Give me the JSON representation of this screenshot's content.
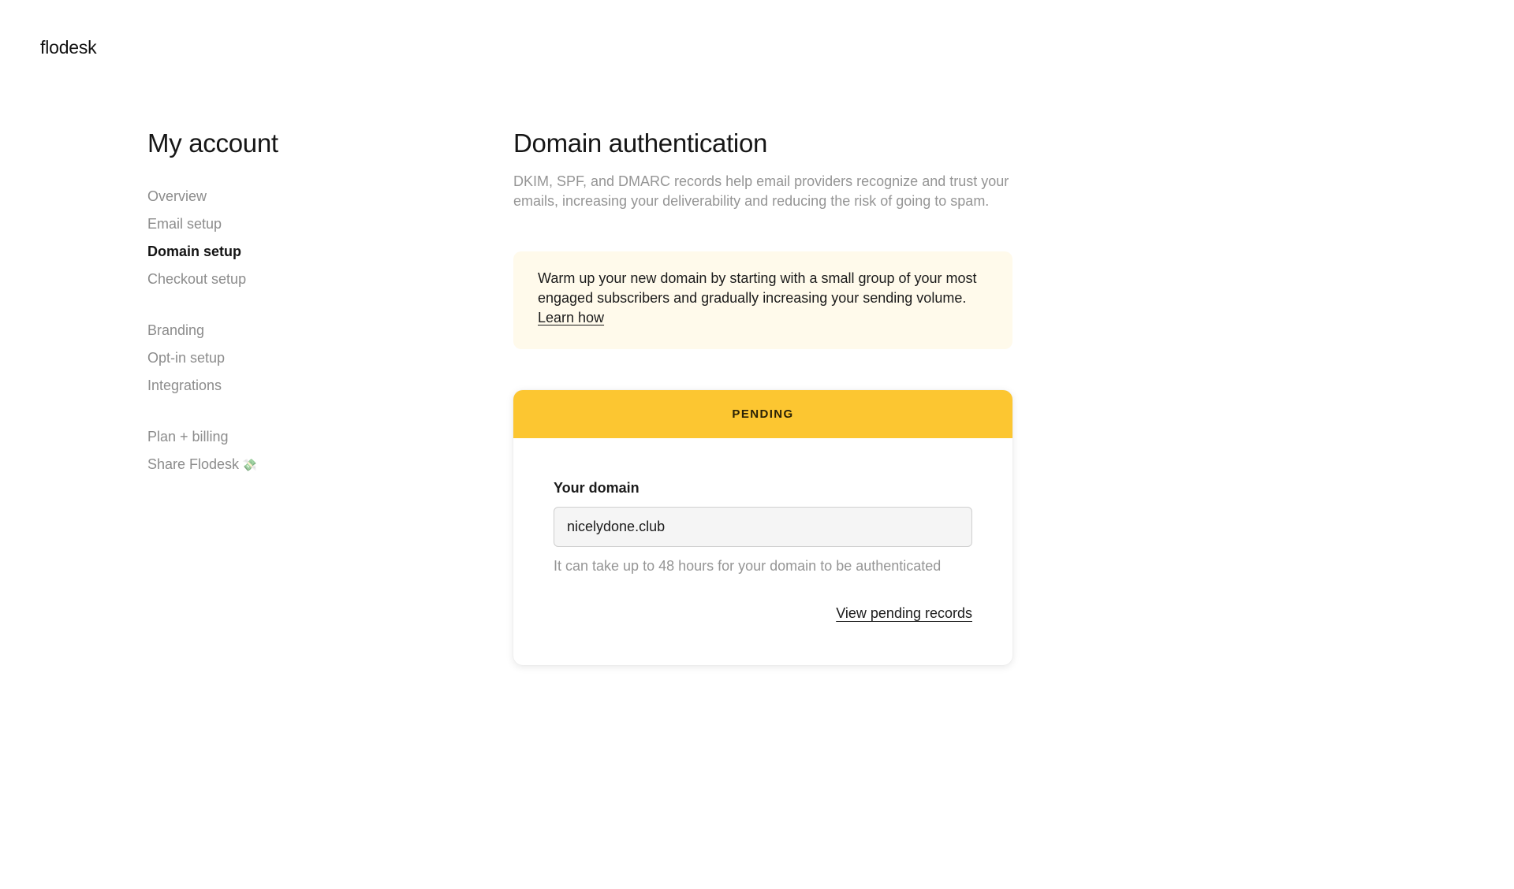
{
  "brand": {
    "logo_text": "flodesk"
  },
  "sidebar": {
    "title": "My account",
    "groups": [
      {
        "items": [
          {
            "label": "Overview",
            "active": false
          },
          {
            "label": "Email setup",
            "active": false
          },
          {
            "label": "Domain setup",
            "active": true
          },
          {
            "label": "Checkout setup",
            "active": false
          }
        ]
      },
      {
        "items": [
          {
            "label": "Branding",
            "active": false
          },
          {
            "label": "Opt-in setup",
            "active": false
          },
          {
            "label": "Integrations",
            "active": false
          }
        ]
      },
      {
        "items": [
          {
            "label": "Plan + billing",
            "active": false
          },
          {
            "label": "Share Flodesk",
            "emoji": "💸",
            "active": false
          }
        ]
      }
    ]
  },
  "main": {
    "title": "Domain authentication",
    "intro": "DKIM, SPF, and DMARC records help email providers recognize and trust your emails, increasing your deliverability and reducing the risk of going to spam.",
    "notice": {
      "text": "Warm up your new domain by starting with a small group of your most engaged subscribers and gradually increasing your sending volume.",
      "link_label": "Learn how"
    },
    "domain_card": {
      "status": "PENDING",
      "status_color": "#fcc631",
      "field_label": "Your domain",
      "field_value": "nicelydone.club",
      "helper_text": "It can take up to 48 hours for your domain to be authenticated",
      "action_label": "View pending records"
    }
  }
}
